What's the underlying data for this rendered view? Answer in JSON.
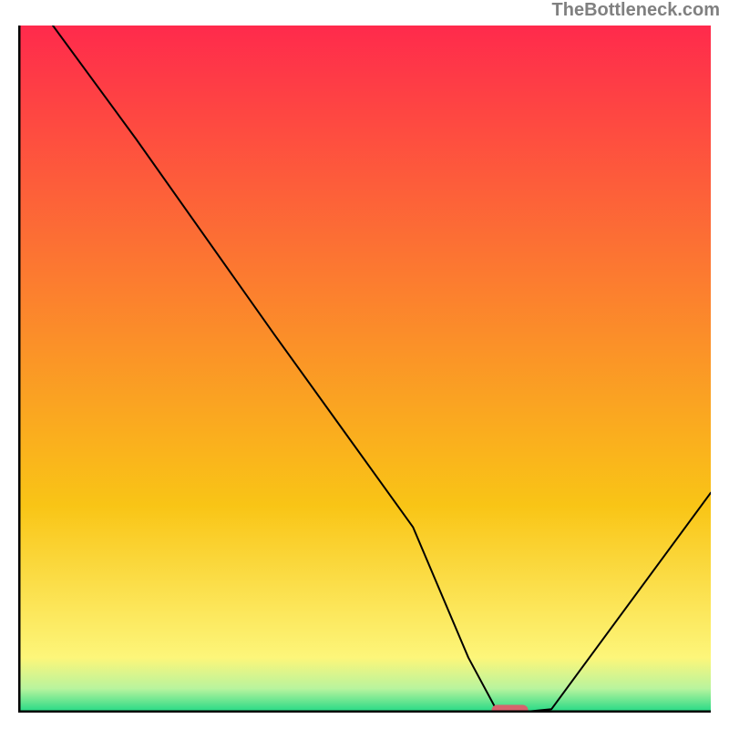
{
  "watermark": "TheBottleneck.com",
  "chart_data": {
    "type": "line",
    "x": [
      0,
      5,
      17,
      37,
      57,
      65,
      69,
      72,
      77,
      100
    ],
    "values": [
      108,
      100,
      83.5,
      55,
      27,
      8,
      0.5,
      0,
      0.5,
      32
    ],
    "title": "",
    "xlabel": "",
    "ylabel": "",
    "xlim": [
      0,
      100
    ],
    "ylim": [
      0,
      100
    ],
    "marker": {
      "x": 71,
      "y": 0
    },
    "axes": {
      "stroke": "#000000",
      "width": 5
    },
    "line": {
      "stroke": "#000000",
      "width": 2
    },
    "bands": [
      {
        "y0": 100,
        "y1": 30,
        "c0": "#ff2a4c",
        "c1": "#f9c516"
      },
      {
        "y0": 30,
        "y1": 8,
        "c0": "#f9c516",
        "c1": "#fdf67a"
      },
      {
        "y0": 8,
        "y1": 3.5,
        "c0": "#fdf67a",
        "c1": "#b8f49e"
      },
      {
        "y0": 3.5,
        "y1": 0,
        "c0": "#b8f49e",
        "c1": "#1cd884"
      }
    ]
  }
}
